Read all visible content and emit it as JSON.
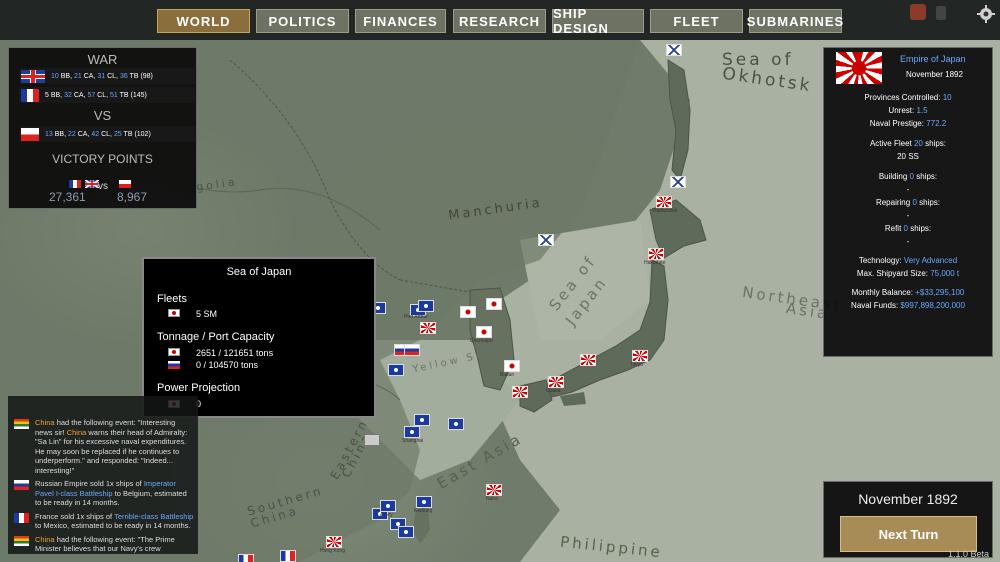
{
  "tabs": [
    "WORLD",
    "POLITICS",
    "FINANCES",
    "RESEARCH",
    "SHIP DESIGN",
    "FLEET",
    "SUBMARINES"
  ],
  "war": {
    "title": "WAR",
    "vs": "VS",
    "ally_rows": [
      {
        "flag": "uk",
        "parts": [
          [
            "10",
            "blue"
          ],
          " BB, ",
          [
            "21",
            "blue"
          ],
          " CA, ",
          [
            "31",
            "blue"
          ],
          " CL, ",
          [
            "36",
            "blue"
          ],
          " TB (98)"
        ]
      },
      {
        "flag": "france",
        "parts": [
          "5 BB, ",
          [
            "32",
            "blue"
          ],
          " CA, ",
          [
            "57",
            "blue"
          ],
          " CL, ",
          [
            "51",
            "blue"
          ],
          " TB (145)"
        ]
      }
    ],
    "enemy_rows": [
      {
        "flag": "poland",
        "parts": [
          [
            "13",
            "blue"
          ],
          " BB, ",
          [
            "22",
            "blue"
          ],
          " CA, ",
          [
            "42",
            "blue"
          ],
          " CL, ",
          [
            "25",
            "blue"
          ],
          " TB (102)"
        ]
      }
    ],
    "victory_title": "VICTORY POINTS",
    "vs_small": "vs",
    "left_points": "27,361",
    "right_points": "8,967"
  },
  "country": {
    "name": "Empire of Japan",
    "date": "November 1892",
    "provinces_label": "Provinces Controlled:",
    "provinces": "10",
    "unrest_label": "Unrest:",
    "unrest": "1.5",
    "prestige_label": "Naval Prestige:",
    "prestige": "772.2",
    "active_fleet_label": "Active Fleet",
    "active_fleet": "20",
    "ships_word": "ships:",
    "active_fleet_ss": "20 SS",
    "building_label": "Building",
    "building": "0",
    "repairing_label": "Repairing",
    "repairing": "0",
    "refit_label": "Refit",
    "refit": "0",
    "dash": "-",
    "tech_label": "Technology:",
    "tech": "Very Advanced",
    "shipyard_label": "Max. Shipyard Size:",
    "shipyard": "75,000 t",
    "balance_label": "Monthly Balance:",
    "balance": "+$33,295,100",
    "funds_label": "Naval Funds:",
    "funds": "$997,898,200,000"
  },
  "tooltip": {
    "title": "Sea of Japan",
    "fleets_label": "Fleets",
    "fleet_value": "5 SM",
    "tonnage_label": "Tonnage / Port Capacity",
    "tonnage_japan": "2651 / 121651 tons",
    "tonnage_russia": "0 / 104570 tons",
    "power_label": "Power Projection",
    "power_value": "0"
  },
  "events": [
    {
      "flag": "china",
      "parts": [
        [
          "China",
          "orange"
        ],
        " had the following event: \"Interesting news sir! ",
        [
          "China",
          "orange"
        ],
        " warns their head of Admiralty: \"Sa Lin\" for his excessive naval expenditures. He may soon be replaced if he continues to underperform.\" and responded: \"Indeed... interesting!\""
      ]
    },
    {
      "flag": "russia",
      "parts": [
        "Russian Empire sold 1x ships of ",
        [
          "Imperator Pavel I-class Battleship",
          "blue"
        ],
        " to Belgium, estimated to be ready in 14 months."
      ]
    },
    {
      "flag": "france",
      "parts": [
        "France sold 1x ships of ",
        [
          "Terrible-class Battleship",
          "blue"
        ],
        " to Mexico, estimated to be ready in 14 months."
      ]
    },
    {
      "flag": "china",
      "parts": [
        [
          "China",
          "orange"
        ],
        " had the following event: \"The Prime Minister believes that our Navy's crew"
      ]
    }
  ],
  "turn": {
    "date": "November 1892",
    "button": "Next Turn"
  },
  "version": "1.1.0 Beta",
  "map_labels": {
    "sea_okhotsk_1": "Sea of",
    "sea_okhotsk_2": "Okhotsk",
    "mongolia": "golia",
    "manchuria": "Manchuria",
    "sea_japan_1": "Sea of",
    "sea_japan_2": "Japan",
    "northeast_1": "Northeast",
    "northeast_2": "Asia",
    "yellow_sea": "Yellow Sea",
    "east_china_1": "Eastern",
    "east_china_2": "China",
    "southern_china_1": "Southern",
    "southern_china_2": "China",
    "east_asia": "East Asia",
    "philippine": "Philippine"
  },
  "cities": [
    "Vladivostok",
    "Port Arthur",
    "Chemulpo",
    "Busan",
    "Hakodate",
    "Shanghai",
    "Hong Kong",
    "Tokyo",
    "Osaka",
    "Naha",
    "Keelung",
    "Amoy"
  ],
  "colors": {
    "accent_blue": "#6aa8ff",
    "event_orange": "#f0a030",
    "tab_active": "#8a6f3c",
    "turn_button": "#a88c57"
  },
  "icons": [
    "japan-flag-large",
    "notification-icon",
    "settings-gear-icon"
  ]
}
